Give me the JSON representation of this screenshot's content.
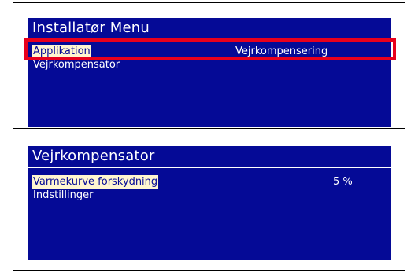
{
  "top_screen": {
    "title": "Installatør Menu",
    "rows": [
      {
        "label": "Applikation",
        "value": "Vejrkompensering"
      },
      {
        "label": "Vejrkompensator",
        "value": ""
      }
    ]
  },
  "bottom_screen": {
    "title": "Vejrkompensator",
    "rows": [
      {
        "label": "Varmekurve forskydning",
        "value": "5 %"
      },
      {
        "label": "Indstillinger",
        "value": ""
      }
    ]
  },
  "colors": {
    "screen_bg": "#050a96",
    "highlight": "#e8001c",
    "selection_bg": "#fff6d0"
  }
}
